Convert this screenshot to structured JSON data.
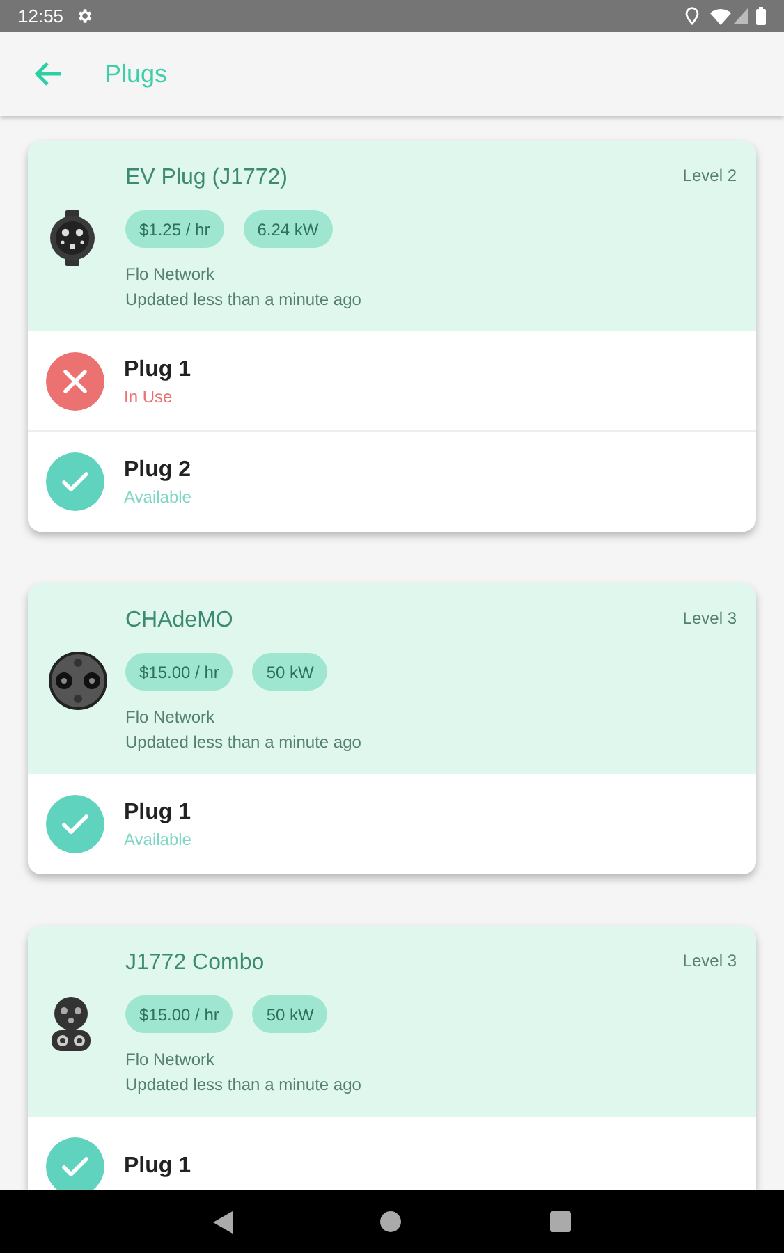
{
  "status_bar": {
    "time": "12:55"
  },
  "app_bar": {
    "title": "Plugs"
  },
  "stations": [
    {
      "kind": "j1772",
      "name": "EV Plug (J1772)",
      "level": "Level 2",
      "price": "$1.25 / hr",
      "power": "6.24 kW",
      "network": "Flo Network",
      "updated": "Updated less than a minute ago",
      "plugs": [
        {
          "name": "Plug 1",
          "kind": "in_use",
          "status_text": "In Use"
        },
        {
          "name": "Plug 2",
          "kind": "available",
          "status_text": "Available"
        }
      ]
    },
    {
      "kind": "chademo",
      "name": "CHAdeMO",
      "level": "Level 3",
      "price": "$15.00 / hr",
      "power": "50 kW",
      "network": "Flo Network",
      "updated": "Updated less than a minute ago",
      "plugs": [
        {
          "name": "Plug 1",
          "kind": "available",
          "status_text": "Available"
        }
      ]
    },
    {
      "kind": "ccs",
      "name": "J1772 Combo",
      "level": "Level 3",
      "price": "$15.00 / hr",
      "power": "50 kW",
      "network": "Flo Network",
      "updated": "Updated less than a minute ago",
      "plugs": [
        {
          "name": "Plug 1",
          "kind": "available"
        }
      ]
    }
  ]
}
